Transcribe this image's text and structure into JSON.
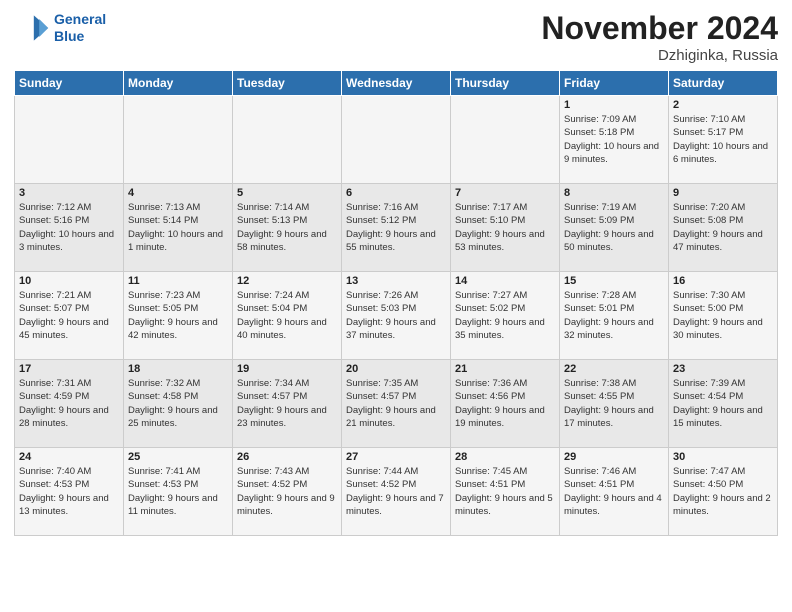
{
  "header": {
    "logo_line1": "General",
    "logo_line2": "Blue",
    "month": "November 2024",
    "location": "Dzhiginka, Russia"
  },
  "weekdays": [
    "Sunday",
    "Monday",
    "Tuesday",
    "Wednesday",
    "Thursday",
    "Friday",
    "Saturday"
  ],
  "weeks": [
    [
      {
        "day": "",
        "info": ""
      },
      {
        "day": "",
        "info": ""
      },
      {
        "day": "",
        "info": ""
      },
      {
        "day": "",
        "info": ""
      },
      {
        "day": "",
        "info": ""
      },
      {
        "day": "1",
        "info": "Sunrise: 7:09 AM\nSunset: 5:18 PM\nDaylight: 10 hours and 9 minutes."
      },
      {
        "day": "2",
        "info": "Sunrise: 7:10 AM\nSunset: 5:17 PM\nDaylight: 10 hours and 6 minutes."
      }
    ],
    [
      {
        "day": "3",
        "info": "Sunrise: 7:12 AM\nSunset: 5:16 PM\nDaylight: 10 hours and 3 minutes."
      },
      {
        "day": "4",
        "info": "Sunrise: 7:13 AM\nSunset: 5:14 PM\nDaylight: 10 hours and 1 minute."
      },
      {
        "day": "5",
        "info": "Sunrise: 7:14 AM\nSunset: 5:13 PM\nDaylight: 9 hours and 58 minutes."
      },
      {
        "day": "6",
        "info": "Sunrise: 7:16 AM\nSunset: 5:12 PM\nDaylight: 9 hours and 55 minutes."
      },
      {
        "day": "7",
        "info": "Sunrise: 7:17 AM\nSunset: 5:10 PM\nDaylight: 9 hours and 53 minutes."
      },
      {
        "day": "8",
        "info": "Sunrise: 7:19 AM\nSunset: 5:09 PM\nDaylight: 9 hours and 50 minutes."
      },
      {
        "day": "9",
        "info": "Sunrise: 7:20 AM\nSunset: 5:08 PM\nDaylight: 9 hours and 47 minutes."
      }
    ],
    [
      {
        "day": "10",
        "info": "Sunrise: 7:21 AM\nSunset: 5:07 PM\nDaylight: 9 hours and 45 minutes."
      },
      {
        "day": "11",
        "info": "Sunrise: 7:23 AM\nSunset: 5:05 PM\nDaylight: 9 hours and 42 minutes."
      },
      {
        "day": "12",
        "info": "Sunrise: 7:24 AM\nSunset: 5:04 PM\nDaylight: 9 hours and 40 minutes."
      },
      {
        "day": "13",
        "info": "Sunrise: 7:26 AM\nSunset: 5:03 PM\nDaylight: 9 hours and 37 minutes."
      },
      {
        "day": "14",
        "info": "Sunrise: 7:27 AM\nSunset: 5:02 PM\nDaylight: 9 hours and 35 minutes."
      },
      {
        "day": "15",
        "info": "Sunrise: 7:28 AM\nSunset: 5:01 PM\nDaylight: 9 hours and 32 minutes."
      },
      {
        "day": "16",
        "info": "Sunrise: 7:30 AM\nSunset: 5:00 PM\nDaylight: 9 hours and 30 minutes."
      }
    ],
    [
      {
        "day": "17",
        "info": "Sunrise: 7:31 AM\nSunset: 4:59 PM\nDaylight: 9 hours and 28 minutes."
      },
      {
        "day": "18",
        "info": "Sunrise: 7:32 AM\nSunset: 4:58 PM\nDaylight: 9 hours and 25 minutes."
      },
      {
        "day": "19",
        "info": "Sunrise: 7:34 AM\nSunset: 4:57 PM\nDaylight: 9 hours and 23 minutes."
      },
      {
        "day": "20",
        "info": "Sunrise: 7:35 AM\nSunset: 4:57 PM\nDaylight: 9 hours and 21 minutes."
      },
      {
        "day": "21",
        "info": "Sunrise: 7:36 AM\nSunset: 4:56 PM\nDaylight: 9 hours and 19 minutes."
      },
      {
        "day": "22",
        "info": "Sunrise: 7:38 AM\nSunset: 4:55 PM\nDaylight: 9 hours and 17 minutes."
      },
      {
        "day": "23",
        "info": "Sunrise: 7:39 AM\nSunset: 4:54 PM\nDaylight: 9 hours and 15 minutes."
      }
    ],
    [
      {
        "day": "24",
        "info": "Sunrise: 7:40 AM\nSunset: 4:53 PM\nDaylight: 9 hours and 13 minutes."
      },
      {
        "day": "25",
        "info": "Sunrise: 7:41 AM\nSunset: 4:53 PM\nDaylight: 9 hours and 11 minutes."
      },
      {
        "day": "26",
        "info": "Sunrise: 7:43 AM\nSunset: 4:52 PM\nDaylight: 9 hours and 9 minutes."
      },
      {
        "day": "27",
        "info": "Sunrise: 7:44 AM\nSunset: 4:52 PM\nDaylight: 9 hours and 7 minutes."
      },
      {
        "day": "28",
        "info": "Sunrise: 7:45 AM\nSunset: 4:51 PM\nDaylight: 9 hours and 5 minutes."
      },
      {
        "day": "29",
        "info": "Sunrise: 7:46 AM\nSunset: 4:51 PM\nDaylight: 9 hours and 4 minutes."
      },
      {
        "day": "30",
        "info": "Sunrise: 7:47 AM\nSunset: 4:50 PM\nDaylight: 9 hours and 2 minutes."
      }
    ]
  ]
}
